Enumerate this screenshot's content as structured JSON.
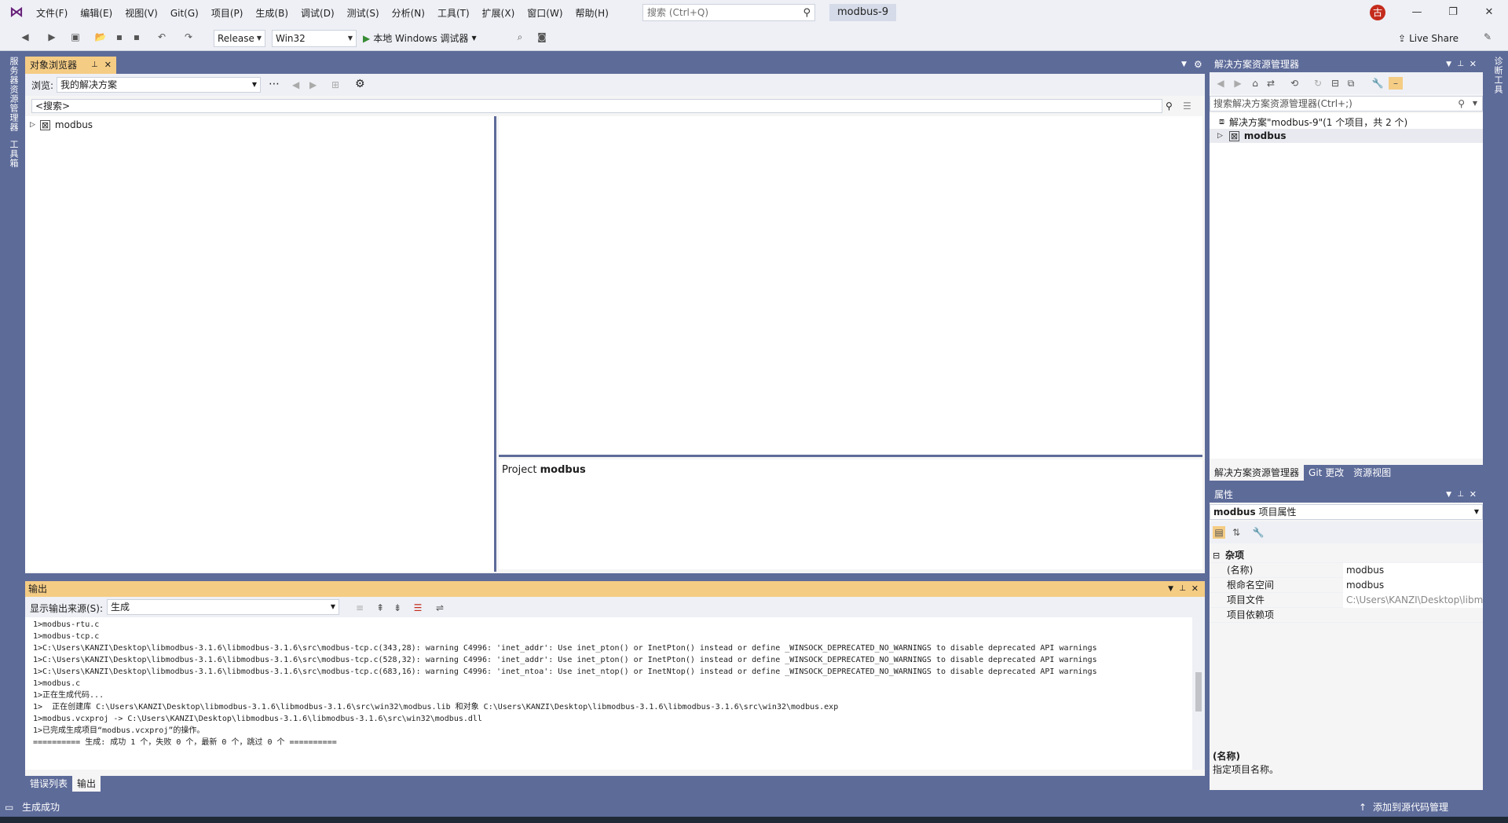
{
  "menu": [
    "文件(F)",
    "编辑(E)",
    "视图(V)",
    "Git(G)",
    "项目(P)",
    "生成(B)",
    "调试(D)",
    "测试(S)",
    "分析(N)",
    "工具(T)",
    "扩展(X)",
    "窗口(W)",
    "帮助(H)"
  ],
  "search": {
    "placeholder": "搜索 (Ctrl+Q)"
  },
  "solution_name": "modbus-9",
  "avatar_initial": "古",
  "toolbar": {
    "config": "Release",
    "platform": "Win32",
    "run_label": "本地 Windows 调试器",
    "live_share": "Live Share"
  },
  "side_left": {
    "server_explorer": "服务器资源管理器",
    "toolbox": "工具箱"
  },
  "side_right": {
    "diagnostics": "诊断工具"
  },
  "object_browser": {
    "tab": "对象浏览器",
    "browse_label": "浏览:",
    "browse_value": "我的解决方案",
    "search_placeholder": "<搜索>",
    "tree_items": [
      "modbus"
    ],
    "desc_prefix": "Project",
    "desc_name": "modbus"
  },
  "solution_explorer": {
    "title": "解决方案资源管理器",
    "search_placeholder": "搜索解决方案资源管理器(Ctrl+;)",
    "solution_node": "解决方案\"modbus-9\"(1 个项目，共 2 个)",
    "project_node": "modbus",
    "tabs": [
      "解决方案资源管理器",
      "Git 更改",
      "资源视图"
    ]
  },
  "properties": {
    "title": "属性",
    "object_name": "modbus",
    "object_type": "项目属性",
    "category": "杂项",
    "rows": [
      {
        "k": "(名称)",
        "v": "modbus"
      },
      {
        "k": "根命名空间",
        "v": "modbus"
      },
      {
        "k": "项目文件",
        "v": "C:\\Users\\KANZI\\Desktop\\libm"
      },
      {
        "k": "项目依赖项",
        "v": ""
      }
    ],
    "desc_title": "(名称)",
    "desc_text": "指定项目名称。"
  },
  "output": {
    "title": "输出",
    "source_label": "显示输出来源(S):",
    "source_value": "生成",
    "lines": [
      "1>modbus-rtu.c",
      "1>modbus-tcp.c",
      "1>C:\\Users\\KANZI\\Desktop\\libmodbus-3.1.6\\libmodbus-3.1.6\\src\\modbus-tcp.c(343,28): warning C4996: 'inet_addr': Use inet_pton() or InetPton() instead or define _WINSOCK_DEPRECATED_NO_WARNINGS to disable deprecated API warnings",
      "1>C:\\Users\\KANZI\\Desktop\\libmodbus-3.1.6\\libmodbus-3.1.6\\src\\modbus-tcp.c(528,32): warning C4996: 'inet_addr': Use inet_pton() or InetPton() instead or define _WINSOCK_DEPRECATED_NO_WARNINGS to disable deprecated API warnings",
      "1>C:\\Users\\KANZI\\Desktop\\libmodbus-3.1.6\\libmodbus-3.1.6\\src\\modbus-tcp.c(683,16): warning C4996: 'inet_ntoa': Use inet_ntop() or InetNtop() instead or define _WINSOCK_DEPRECATED_NO_WARNINGS to disable deprecated API warnings",
      "1>modbus.c",
      "1>正在生成代码...",
      "1>  正在创建库 C:\\Users\\KANZI\\Desktop\\libmodbus-3.1.6\\libmodbus-3.1.6\\src\\win32\\modbus.lib 和对象 C:\\Users\\KANZI\\Desktop\\libmodbus-3.1.6\\libmodbus-3.1.6\\src\\win32\\modbus.exp",
      "1>modbus.vcxproj -> C:\\Users\\KANZI\\Desktop\\libmodbus-3.1.6\\libmodbus-3.1.6\\src\\win32\\modbus.dll",
      "1>已完成生成项目“modbus.vcxproj”的操作。",
      "========== 生成: 成功 1 个，失败 0 个，最新 0 个，跳过 0 个 =========="
    ],
    "tabs": [
      "错误列表",
      "输出"
    ]
  },
  "status": {
    "left": "生成成功",
    "right": "添加到源代码管理"
  },
  "colors": {
    "accent": "#5d6b99",
    "active_tab": "#f5cc84",
    "chrome": "#eef0f5"
  }
}
